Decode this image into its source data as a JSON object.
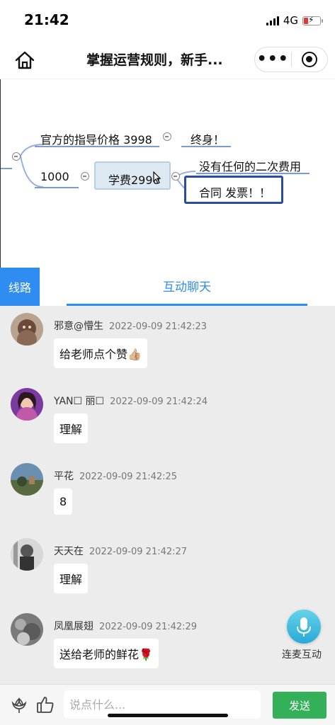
{
  "status_bar": {
    "time": "21:42",
    "network": "4G"
  },
  "nav": {
    "title": "掌握运营规则，新手..."
  },
  "video": {
    "official_price": "官方的指导价格 3998",
    "lifetime": "终身！",
    "price_1000": "1000",
    "fee": "学费2990",
    "no_extra_fee": "没有任何的二次费用",
    "contract_invoice": "合同 发票！！"
  },
  "tabs": {
    "route": "线路",
    "chat": "互动聊天"
  },
  "messages": [
    {
      "name": "邪意@懵生",
      "time": "2022-09-09 21:42:23",
      "text": "给老师点个赞👍🏼"
    },
    {
      "name": "YAN☐  丽☐",
      "time": "2022-09-09 21:42:24",
      "text": "理解"
    },
    {
      "name": "平花",
      "time": "2022-09-09 21:42:25",
      "text": "8"
    },
    {
      "name": "天天在",
      "time": "2022-09-09 21:42:27",
      "text": "理解"
    },
    {
      "name": "凤凰展翅",
      "time": "2022-09-09 21:42:29",
      "text": "送给老师的鲜花🌹"
    }
  ],
  "mic": {
    "label": "连麦互动"
  },
  "input": {
    "placeholder": "说点什么...",
    "send_label": "发送"
  },
  "colors": {
    "accent": "#2f8cf0",
    "send": "#34b158",
    "chat_bg": "#ececec"
  }
}
